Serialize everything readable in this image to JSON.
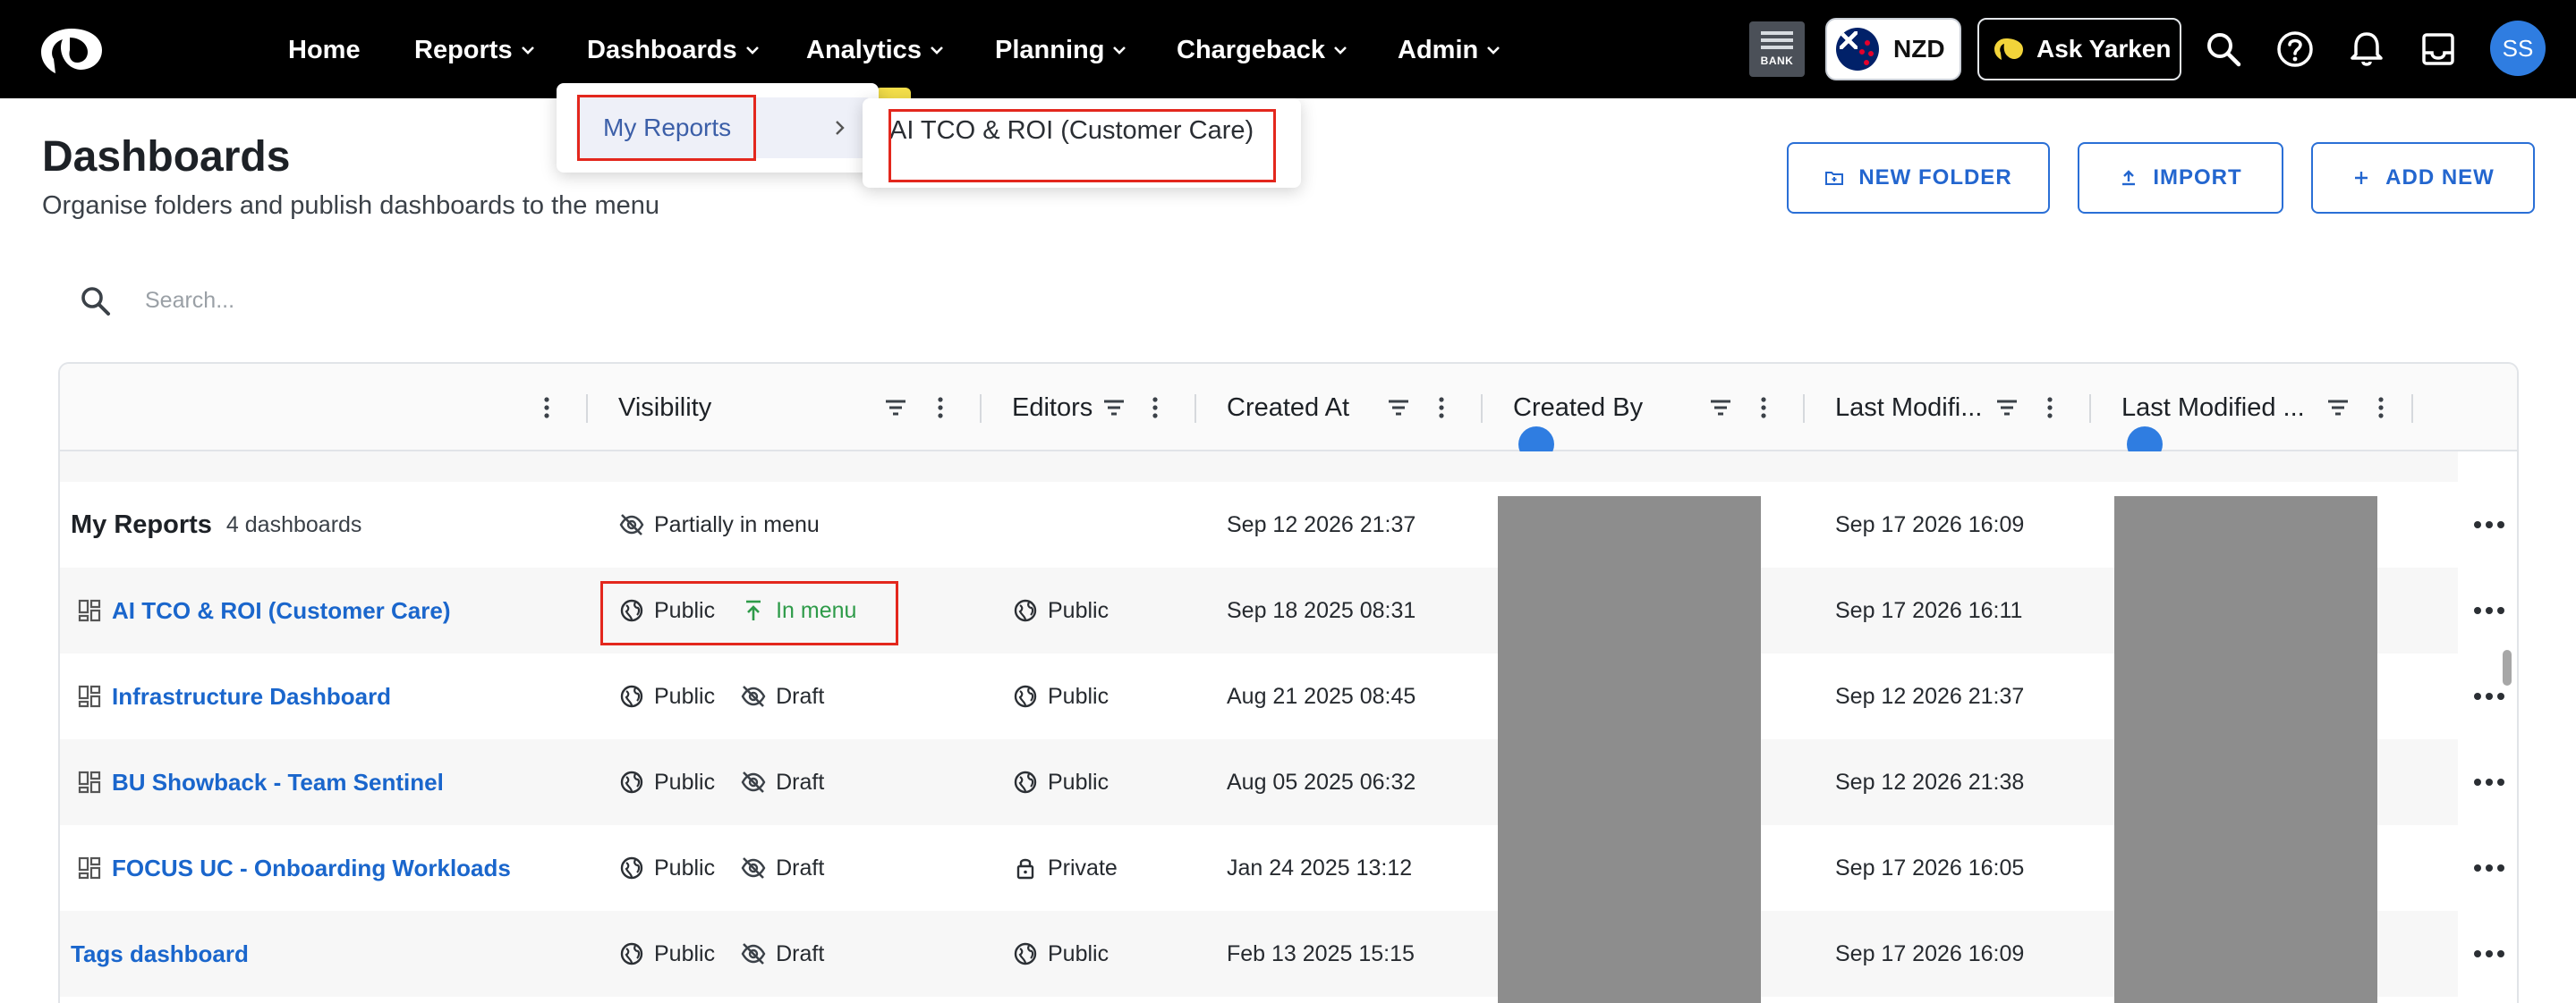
{
  "nav": {
    "items": [
      {
        "label": "Home",
        "dropdown": false
      },
      {
        "label": "Reports",
        "dropdown": true
      },
      {
        "label": "Dashboards",
        "dropdown": true
      },
      {
        "label": "Analytics",
        "dropdown": true
      },
      {
        "label": "Planning",
        "dropdown": true
      },
      {
        "label": "Chargeback",
        "dropdown": true
      },
      {
        "label": "Admin",
        "dropdown": true
      }
    ],
    "bank_label": "BANK",
    "currency": "NZD",
    "ask_label": "Ask Yarken",
    "avatar_initials": "SS"
  },
  "dropdown": {
    "submenu_label": "My Reports",
    "submenu_item": "AI TCO & ROI (Customer Care)"
  },
  "page": {
    "title": "Dashboards",
    "subtitle": "Organise folders and publish dashboards to the menu",
    "buttons": {
      "new_folder": "NEW FOLDER",
      "import": "IMPORT",
      "add_new": "ADD NEW"
    }
  },
  "search": {
    "placeholder": "Search..."
  },
  "grid": {
    "columns": [
      "Visibility",
      "Editors",
      "Created At",
      "Created By",
      "Last Modifi...",
      "Last Modified ..."
    ],
    "folder": {
      "name": "My Reports",
      "count": "4 dashboards",
      "visibility": "Partially in menu",
      "created_at": "Sep 12 2026 21:37",
      "modified_at": "Sep 17 2026 16:09"
    },
    "rows": [
      {
        "name": "AI TCO & ROI (Customer Care)",
        "visibility": "Public",
        "status": "In menu",
        "editors": "Public",
        "editors_icon": "globe-icon",
        "created_at": "Sep 18 2025 08:31",
        "modified_at": "Sep 17 2026 16:11"
      },
      {
        "name": "Infrastructure Dashboard",
        "visibility": "Public",
        "status": "Draft",
        "editors": "Public",
        "editors_icon": "globe-icon",
        "created_at": "Aug 21 2025 08:45",
        "modified_at": "Sep 12 2026 21:37"
      },
      {
        "name": "BU Showback - Team Sentinel",
        "visibility": "Public",
        "status": "Draft",
        "editors": "Public",
        "editors_icon": "globe-icon",
        "created_at": "Aug 05 2025 06:32",
        "modified_at": "Sep 12 2026 21:38"
      },
      {
        "name": "FOCUS UC - Onboarding Workloads",
        "visibility": "Public",
        "status": "Draft",
        "editors": "Private",
        "editors_icon": "lock-icon",
        "created_at": "Jan 24 2025 13:12",
        "modified_at": "Sep 17 2026 16:05"
      }
    ],
    "tags_row": {
      "name": "Tags dashboard",
      "visibility": "Public",
      "status": "Draft",
      "editors": "Public",
      "created_at": "Feb 13 2025 15:15",
      "modified_at": "Sep 17 2026 16:09"
    }
  },
  "colors": {
    "accent": "#1a66cc",
    "in_menu": "#2e9b49",
    "highlight": "#e3271d",
    "redacted": "#8d8d8d"
  }
}
